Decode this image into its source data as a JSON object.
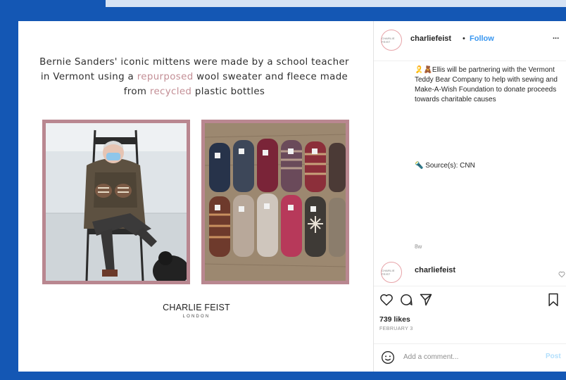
{
  "post_graphic": {
    "headline_part1": "Bernie Sanders' iconic mittens were made by a school teacher in Vermont using a ",
    "headline_accent1": "repurposed",
    "headline_part2": " wool sweater and fleece made from ",
    "headline_accent2": "recycled",
    "headline_part3": " plastic bottles",
    "accent_color": "#c38e95",
    "frame_color": "#b98790",
    "brand_name": "CHARLIE FEIST",
    "brand_sub": "LONDON"
  },
  "sidebar": {
    "avatar_text": "CHARLIE FEIST",
    "username": "charliefeist",
    "separator": "•",
    "follow_label": "Follow",
    "more_label": "...",
    "caption": "🎗️🧸Ellis will be partnering with the Vermont Teddy Bear Company to help with sewing and Make-A-Wish Foundation to donate proceeds towards charitable causes",
    "source": "🔦 Source(s): CNN",
    "time_ago": "8w",
    "comment_username": "charliefeist",
    "likes": "739 likes",
    "date": "FEBRUARY 3",
    "comment_placeholder": "Add a comment...",
    "post_label": "Post"
  },
  "colors": {
    "background_blue": "#1457b4",
    "link_blue": "#3896f0"
  }
}
